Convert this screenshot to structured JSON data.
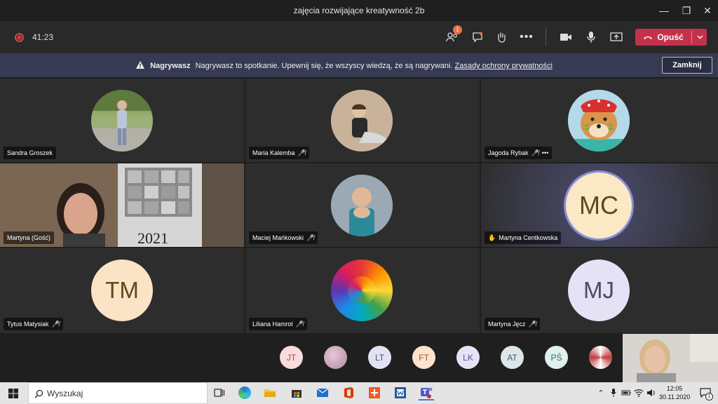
{
  "window": {
    "title": "zajęcia rozwijające kreatywność 2b"
  },
  "toolbar": {
    "timer": "41:23",
    "participants_badge": "1",
    "leave_label": "Opuść"
  },
  "banner": {
    "bold": "Nagrywasz",
    "text": "Nagrywasz to spotkanie. Upewnij się, że wszyscy wiedzą, że są nagrywani.",
    "link": "Zasady ochrony prywatności",
    "close_label": "Zamknij"
  },
  "tiles": [
    {
      "name": "Sandra Groszek",
      "initials": "",
      "muted": false
    },
    {
      "name": "Maria Kalemba",
      "initials": "",
      "muted": true
    },
    {
      "name": "Jagoda Rybak",
      "initials": "",
      "muted": true
    },
    {
      "name": "Martyna (Gość)",
      "initials": "",
      "muted": false
    },
    {
      "name": "Maciej Mańkowski",
      "initials": "",
      "muted": true
    },
    {
      "name": "Martyna Centkowska",
      "initials": "MC",
      "muted": false,
      "hand_raised": true
    },
    {
      "name": "Tytus Matysiak",
      "initials": "TM",
      "muted": true
    },
    {
      "name": "Liliana Hamrol",
      "initials": "",
      "muted": true
    },
    {
      "name": "Martyna Jęcz",
      "initials": "MJ",
      "muted": true
    }
  ],
  "video_overlay_text": "2021",
  "strip": [
    "JT",
    "",
    "LT",
    "FT",
    "LK",
    "AT",
    "PŚ",
    ""
  ],
  "taskbar": {
    "search_placeholder": "Wyszukaj",
    "time": "12:05",
    "date": "30.11.2020",
    "notification_count": "1"
  },
  "colors": {
    "leave": "#c4314b",
    "banner": "#363a52",
    "badge": "#e8704b"
  }
}
